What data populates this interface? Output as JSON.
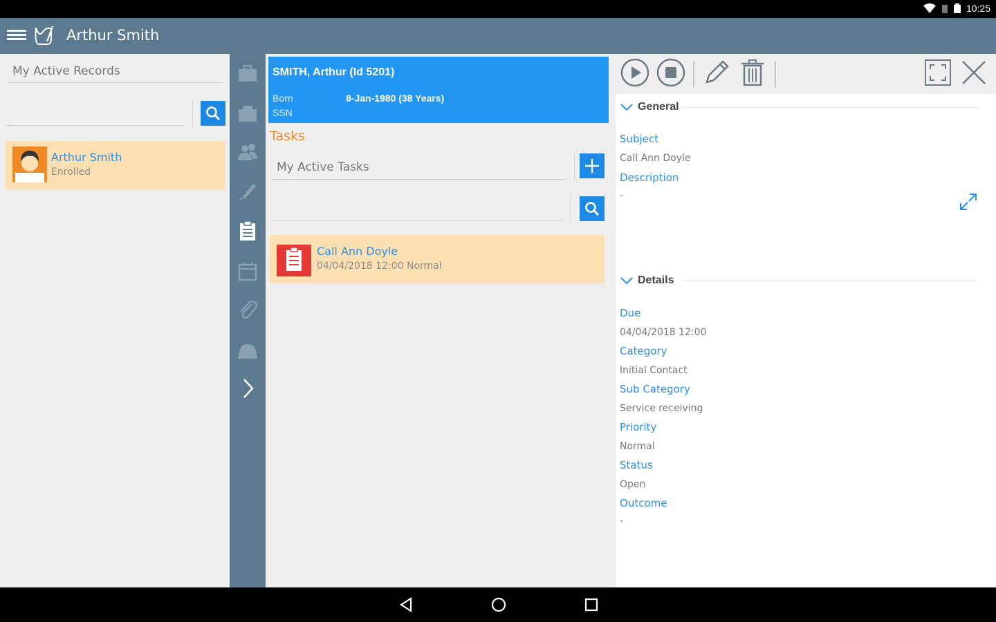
{
  "status_bar": {
    "time": "10:25"
  },
  "app_bar": {
    "title": "Arthur Smith"
  },
  "left_panel": {
    "filter_value": "My Active Records",
    "search_value": "",
    "records": [
      {
        "name": "Arthur Smith",
        "status": "Enrolled"
      }
    ]
  },
  "sidebar_icons": [
    "briefcase-icon",
    "case-icon",
    "contacts-icon",
    "signature-icon",
    "tasks-icon",
    "calendar-icon",
    "attachment-icon",
    "dome-icon",
    "chevron-right-icon"
  ],
  "patient": {
    "title": "SMITH, Arthur (Id 5201)",
    "born_label": "Born",
    "born_value": "8-Jan-1980 (38 Years)",
    "ssn_label": "SSN"
  },
  "tasks": {
    "section_label": "Tasks",
    "filter_value": "My Active Tasks",
    "items": [
      {
        "title": "Call Ann Doyle",
        "meta": "04/04/2018 12:00 Normal"
      }
    ]
  },
  "detail": {
    "general_label": "General",
    "subject_label": "Subject",
    "subject_value": "Call Ann Doyle",
    "description_label": "Description",
    "description_value": "-",
    "details_label": "Details",
    "due_label": "Due",
    "due_value": "04/04/2018 12:00",
    "category_label": "Category",
    "category_value": "Initial Contact",
    "subcategory_label": "Sub Category",
    "subcategory_value": "Service receiving",
    "priority_label": "Priority",
    "priority_value": "Normal",
    "status_label": "Status",
    "status_value": "Open",
    "outcome_label": "Outcome",
    "outcome_value": "-"
  },
  "colors": {
    "accent": "#2196f3",
    "appbar": "#5b7a90",
    "highlight": "#fde0b2",
    "orange": "#f08a24"
  }
}
